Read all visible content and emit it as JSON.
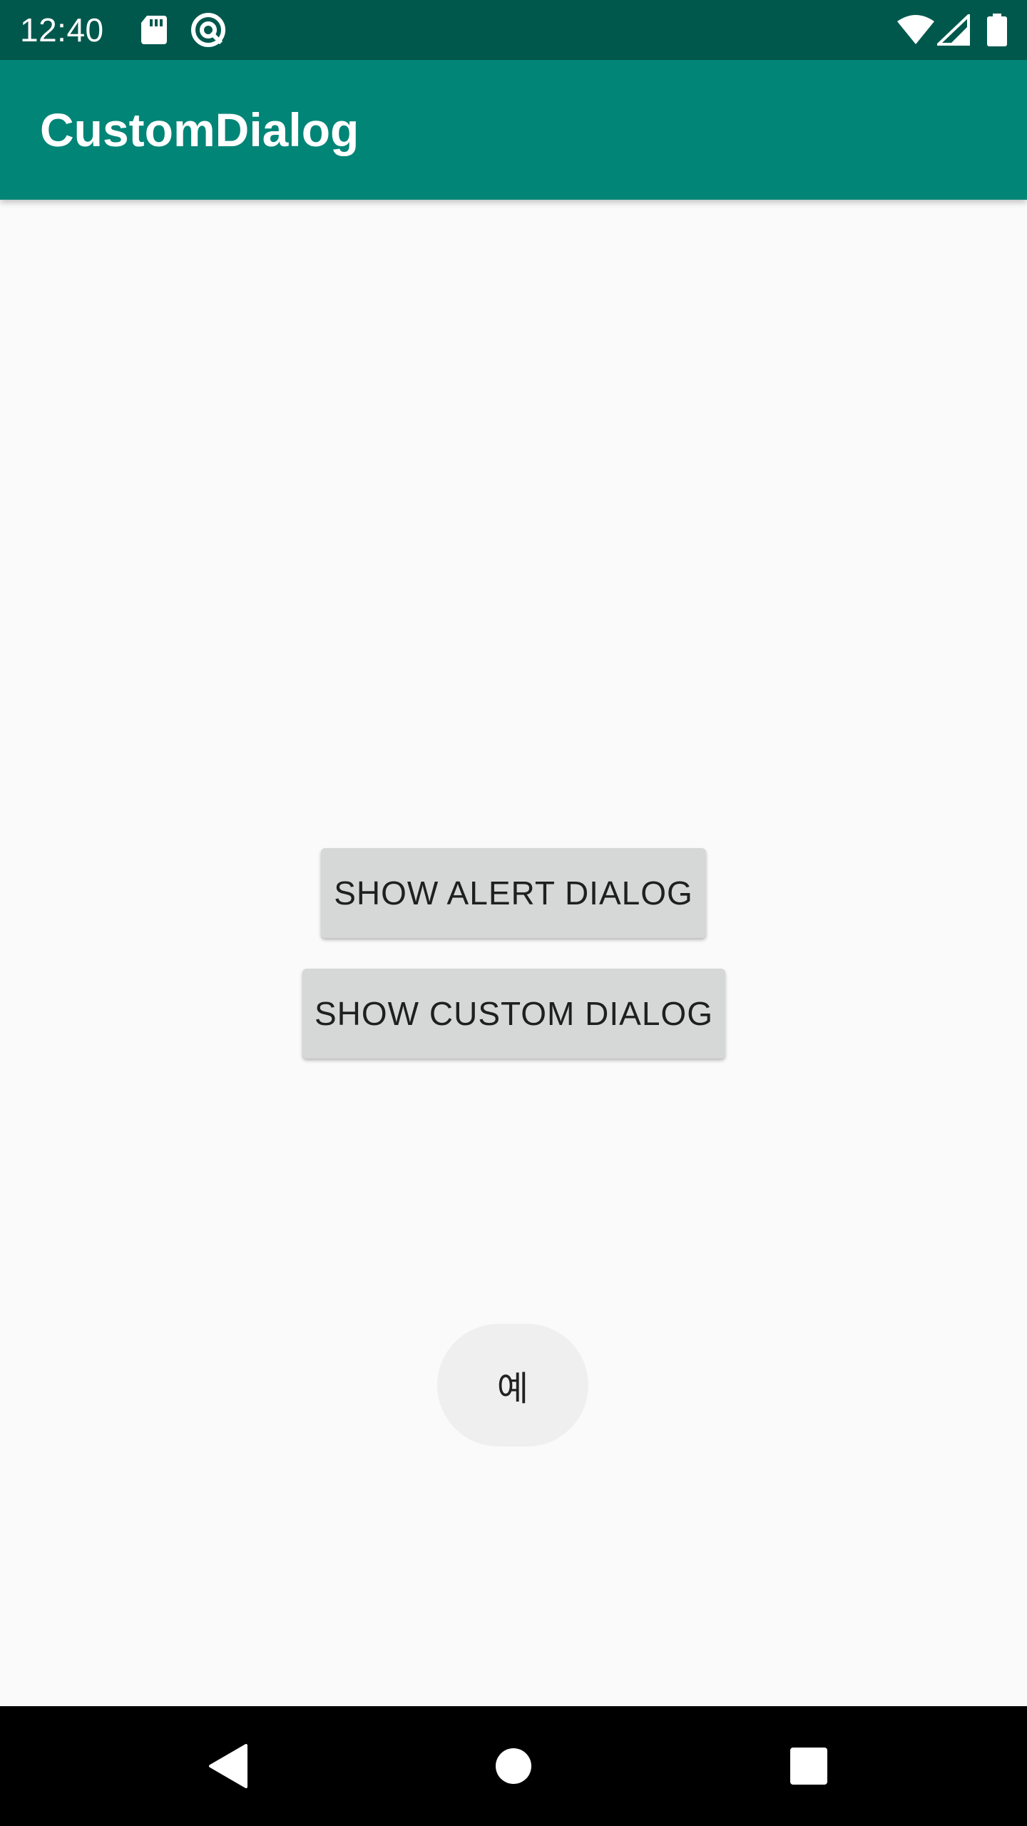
{
  "status_bar": {
    "time": "12:40",
    "icons": [
      "sd-card-icon",
      "data-saver-icon",
      "wifi-icon",
      "cell-signal-icon",
      "battery-icon"
    ]
  },
  "app_bar": {
    "title": "CustomDialog"
  },
  "main": {
    "buttons": [
      {
        "label": "SHOW ALERT DIALOG"
      },
      {
        "label": "SHOW CUSTOM DIALOG"
      }
    ]
  },
  "toast": {
    "text": "예"
  },
  "nav_bar": {
    "buttons": [
      "back-icon",
      "home-icon",
      "recents-icon"
    ]
  },
  "colors": {
    "status_bar": "#00584d",
    "app_bar": "#008577",
    "background": "#fafafa",
    "button": "#d6d7d7",
    "toast": "#efefef",
    "nav_bar": "#000000"
  }
}
